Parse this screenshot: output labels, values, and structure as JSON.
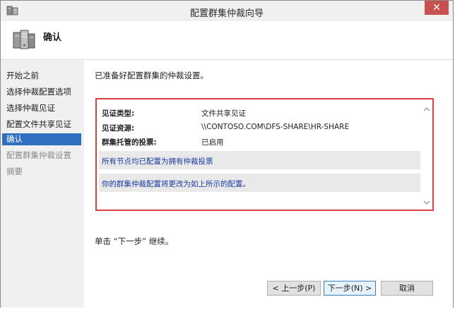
{
  "window": {
    "title": "配置群集仲裁向导",
    "close_glyph": "✕"
  },
  "header": {
    "title": "确认"
  },
  "sidebar": {
    "items": [
      {
        "label": "开始之前",
        "state": "normal"
      },
      {
        "label": "选择仲裁配置选项",
        "state": "normal"
      },
      {
        "label": "选择仲裁见证",
        "state": "normal"
      },
      {
        "label": "配置文件共享见证",
        "state": "normal"
      },
      {
        "label": "确认",
        "state": "selected"
      },
      {
        "label": "配置群集仲裁设置",
        "state": "disabled"
      },
      {
        "label": "摘要",
        "state": "disabled"
      }
    ]
  },
  "main": {
    "intro": "已准备好配置群集的仲裁设置。",
    "summary": {
      "rows": [
        {
          "label": "见证类型:",
          "value": "文件共享见证"
        },
        {
          "label": "见证资源:",
          "value": "\\\\CONTOSO.COM\\DFS-SHARE\\HR-SHARE"
        },
        {
          "label": "群集托管的投票:",
          "value": "已启用"
        }
      ],
      "notes": [
        "所有节点均已配置为拥有仲裁投票",
        "你的群集仲裁配置将更改为如上所示的配置。"
      ]
    },
    "continue_text": "单击 “下一步” 继续。"
  },
  "buttons": {
    "back": "< 上一步(P)",
    "next": "下一步(N) >",
    "cancel": "取消"
  },
  "icons": {
    "title": "wizard-server-icon",
    "header": "cluster-servers-icon",
    "scroll_up": "chevron-up-icon",
    "scroll_down": "chevron-down-icon"
  },
  "colors": {
    "selection": "#2f6fc0",
    "highlight_border": "#d94040",
    "note_text": "#1a3aa0",
    "close_button": "#c75050"
  }
}
